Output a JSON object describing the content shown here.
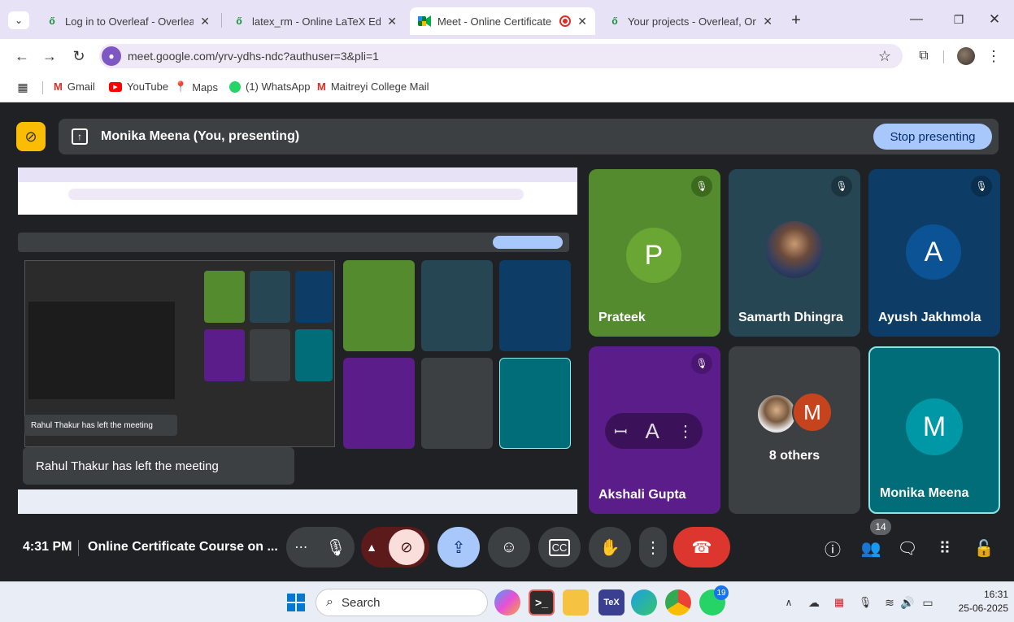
{
  "browser": {
    "tabs": [
      {
        "title": "Log in to Overleaf - Overleaf, O",
        "icon": "overleaf-icon"
      },
      {
        "title": "latex_rm - Online LaTeX Editor O",
        "icon": "overleaf-icon"
      },
      {
        "title": "Meet - Online Certificate Co",
        "icon": "meet-icon",
        "active": true
      },
      {
        "title": "Your projects - Overleaf, Online",
        "icon": "overleaf-icon"
      }
    ],
    "url": "meet.google.com/yrv-ydhs-ndc?authuser=3&pli=1",
    "bookmarks": [
      "Gmail",
      "YouTube",
      "Maps",
      "(1) WhatsApp",
      "Maitreyi College Mail"
    ]
  },
  "meet": {
    "presenting_text": "Monika Meena (You, presenting)",
    "stop_presenting_label": "Stop presenting",
    "participants": [
      {
        "name": "Prateek",
        "initial": "P",
        "color": "#5b8a2f",
        "tile_color": "#558b2f"
      },
      {
        "name": "Samarth Dhingra",
        "initial": "",
        "tile_color": "#264653"
      },
      {
        "name": "Ayush Jakhmola",
        "initial": "A",
        "color": "#0b5394",
        "tile_color": "#0d3d66"
      },
      {
        "name": "Akshali Gupta",
        "initial": "A",
        "tile_color": "#5b1d8a"
      },
      {
        "name": "8 others",
        "initial": "M",
        "tile_color": "#3c4043"
      },
      {
        "name": "Monika Meena",
        "initial": "M",
        "color": "#0097a7",
        "tile_color": "#006d78"
      }
    ],
    "others_avatar_initial": "M",
    "toast": "Rahul Thakur has left the meeting",
    "nested_toast": "Rahul Thakur has left the meeting",
    "time": "4:31 PM",
    "meeting_title": "Online Certificate Course on ...",
    "people_count": "14"
  },
  "taskbar": {
    "search_label": "Search",
    "clock_time": "16:31",
    "clock_date": "25-06-2025",
    "whatsapp_badge": "19"
  }
}
